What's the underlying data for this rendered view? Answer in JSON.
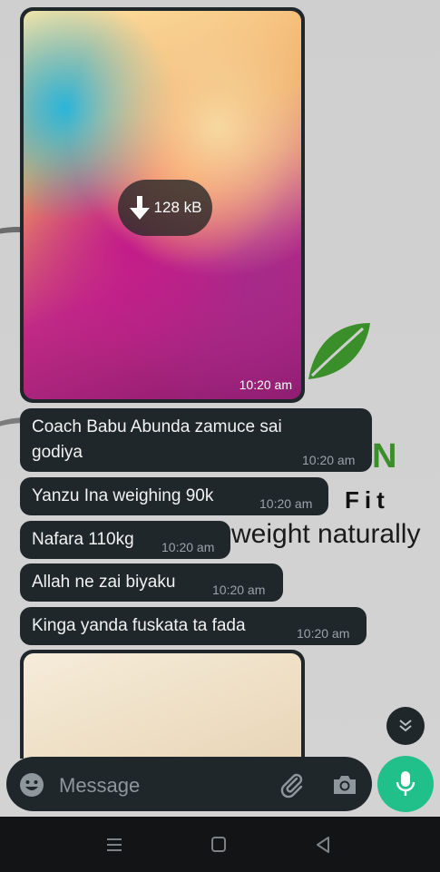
{
  "chat": {
    "image_message": {
      "download_size": "128 kB",
      "time": "10:20 am"
    },
    "messages": [
      {
        "text_line1": "Coach Babu Abunda zamuce sai",
        "text_line2": "godiya",
        "time": "10:20 am"
      },
      {
        "text": "Yanzu Ina weighing 90k",
        "time": "10:20 am"
      },
      {
        "text": "Nafara 110kg",
        "time": "10:20 am"
      },
      {
        "text": "Allah ne zai biyaku",
        "time": "10:20 am"
      },
      {
        "text": "Kinga yanda fuskata ta fada",
        "time": "10:20 am"
      }
    ]
  },
  "wallpaper": {
    "brand_letter": "N",
    "brand_fit": "Fit",
    "brand_tagline": "weight naturally"
  },
  "composer": {
    "placeholder": "Message"
  },
  "icons": {
    "download": "download-arrow-icon",
    "scroll_down": "double-chevron-down-icon",
    "emoji": "emoji-icon",
    "attach": "paperclip-icon",
    "camera": "camera-icon",
    "mic": "microphone-icon",
    "nav_menu": "menu-icon",
    "nav_home": "home-square-icon",
    "nav_back": "back-triangle-icon"
  },
  "colors": {
    "bubble": "#1f272b",
    "accent": "#21c08b",
    "brand_green": "#3a8f2a"
  }
}
